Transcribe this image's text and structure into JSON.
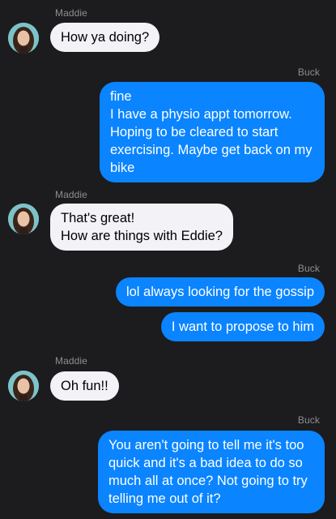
{
  "messages": [
    {
      "sender": "Maddie",
      "direction": "in",
      "text": "How ya doing?"
    },
    {
      "sender": "Buck",
      "direction": "out",
      "text": "fine\nI have a physio appt tomorrow. Hoping to be cleared to start exercising. Maybe get back on my bike"
    },
    {
      "sender": "Maddie",
      "direction": "in",
      "text": "That's great!\nHow are things with Eddie?"
    },
    {
      "sender": "Buck",
      "direction": "out",
      "text": "lol always looking for the gossip"
    },
    {
      "sender": "Buck",
      "direction": "out",
      "text": "I want to propose to him"
    },
    {
      "sender": "Maddie",
      "direction": "in",
      "text": "Oh fun!!"
    },
    {
      "sender": "Buck",
      "direction": "out",
      "text": "You aren't going to tell me it's too quick and it's a bad idea to do so much all at once? Not going to try telling me out of it?"
    }
  ],
  "colors": {
    "background": "#1c1c1e",
    "incoming_bubble": "#f2f2f7",
    "outgoing_bubble": "#0a84ff",
    "sender_name": "#8e8e93"
  },
  "icons": {
    "avatar": "contact-avatar-icon"
  }
}
